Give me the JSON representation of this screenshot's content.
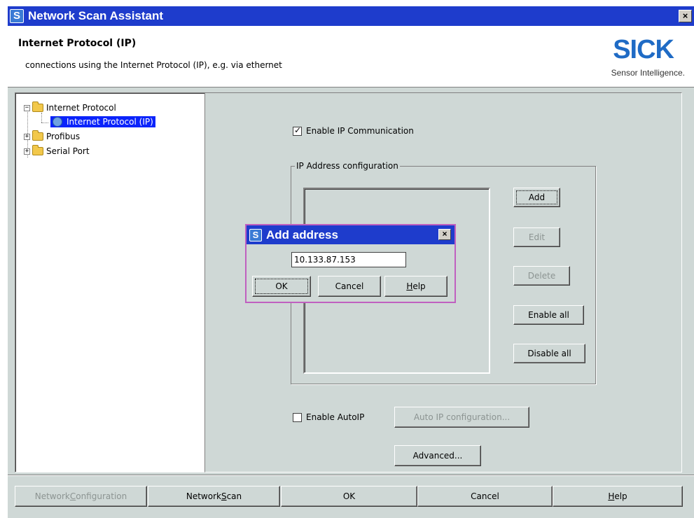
{
  "window": {
    "title": "Network Scan Assistant",
    "close_glyph": "×"
  },
  "header": {
    "title": "Internet Protocol (IP)",
    "subtitle": "connections using the Internet Protocol (IP), e.g. via ethernet",
    "logo": "SICK",
    "logo_tagline": "Sensor Intelligence.",
    "logo_color": "#1f6bc5"
  },
  "tree": {
    "items": [
      {
        "label": "Internet Protocol",
        "icon": "folder-icon",
        "expanded": true
      },
      {
        "label": "Internet Protocol (IP)",
        "icon": "globe-icon",
        "selected": true
      },
      {
        "label": "Profibus",
        "icon": "folder-icon",
        "expanded": false
      },
      {
        "label": "Serial Port",
        "icon": "folder-icon",
        "expanded": false
      }
    ]
  },
  "ip": {
    "enable_ip_label": "Enable IP Communication",
    "enable_ip_checked": true,
    "group_label": "IP Address configuration",
    "add_label": "Add",
    "edit_label": "Edit",
    "delete_label": "Delete",
    "enable_all_label": "Enable all",
    "disable_all_label": "Disable all",
    "enable_autoip_label": "Enable AutoIP",
    "enable_autoip_checked": false,
    "auto_ip_config_label": "Auto IP configuration...",
    "advanced_label": "Advanced..."
  },
  "footer": {
    "network_configuration": {
      "pre": "Network ",
      "ul": "C",
      "post": "onfiguration"
    },
    "network_scan": {
      "pre": "Network ",
      "ul": "S",
      "post": "can"
    },
    "ok": "OK",
    "cancel": "Cancel",
    "help": {
      "pre": "",
      "ul": "H",
      "post": "elp"
    }
  },
  "dialog": {
    "title": "Add address",
    "close_glyph": "×",
    "address_value": "10.133.87.153",
    "ok_label": "OK",
    "cancel_label": "Cancel",
    "help": {
      "pre": "",
      "ul": "H",
      "post": "elp"
    }
  },
  "colors": {
    "titlebar": "#1e3ccc",
    "selection": "#0b24fb",
    "dialog_border": "#c060c0",
    "face": "#cfd8d6"
  }
}
